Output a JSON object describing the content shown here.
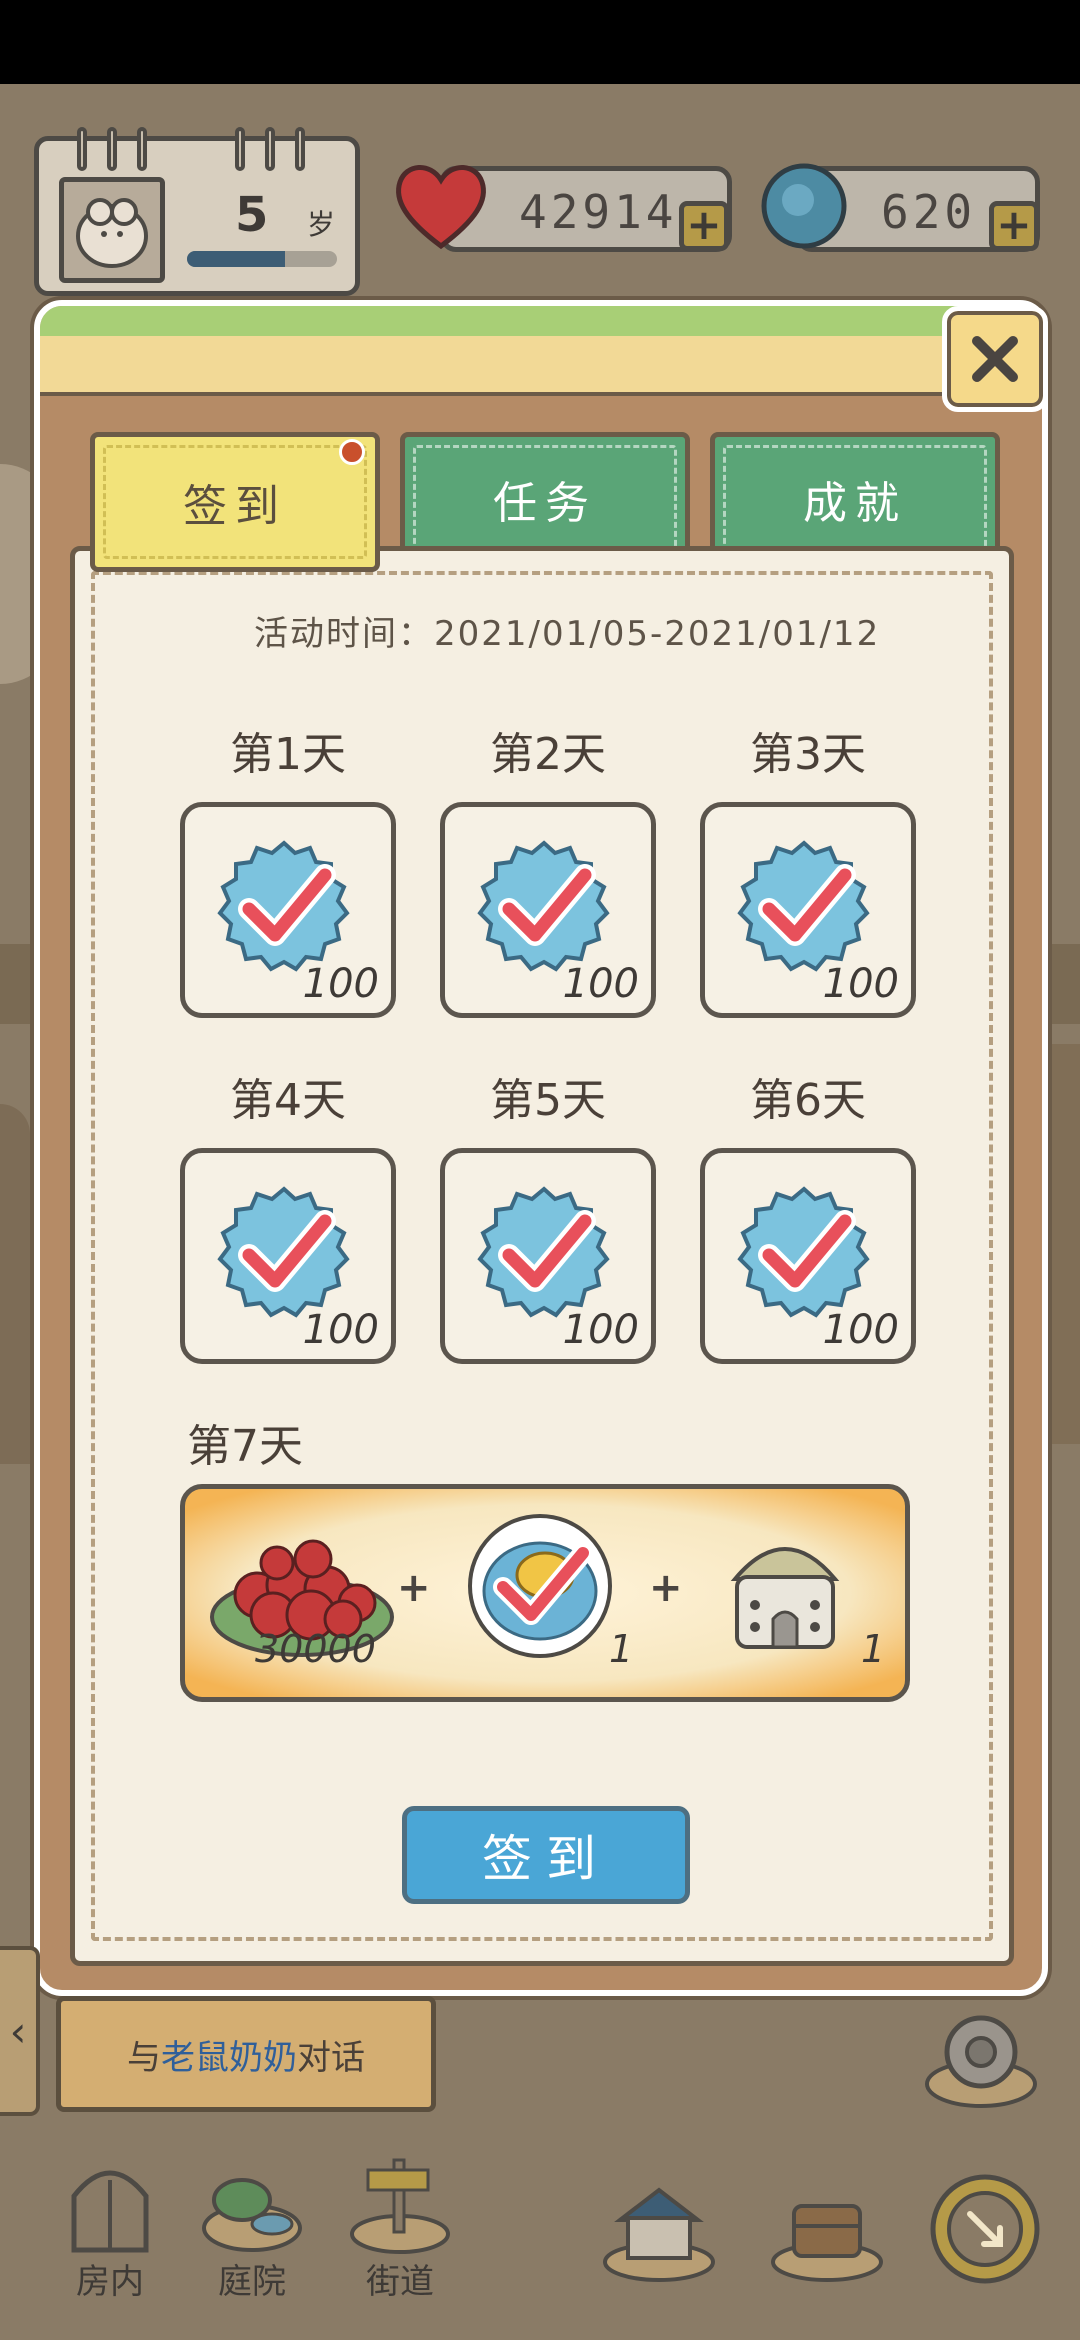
{
  "hud": {
    "age_value": "5",
    "age_unit": "岁",
    "age_progress": 0.65,
    "hearts": "42914",
    "caps": "620",
    "plus": "+"
  },
  "popup": {
    "close_icon": "close-icon",
    "tabs": [
      {
        "label": "签到",
        "active": true,
        "has_badge": true
      },
      {
        "label": "任务",
        "active": false
      },
      {
        "label": "成就",
        "active": false
      }
    ],
    "event_time": "活动时间：2021/01/05-2021/01/12",
    "days": [
      {
        "label": "第1天",
        "amount": "100",
        "claimed": true
      },
      {
        "label": "第2天",
        "amount": "100",
        "claimed": true
      },
      {
        "label": "第3天",
        "amount": "100",
        "claimed": true
      },
      {
        "label": "第4天",
        "amount": "100",
        "claimed": true
      },
      {
        "label": "第5天",
        "amount": "100",
        "claimed": true
      },
      {
        "label": "第6天",
        "amount": "100",
        "claimed": true
      }
    ],
    "day7": {
      "label": "第7天",
      "rewards": [
        {
          "icon": "hearts-plate-icon",
          "qty": "30000"
        },
        {
          "icon": "egg-plate-icon",
          "qty": "1",
          "claimed": true
        },
        {
          "icon": "house-icon",
          "qty": "1"
        }
      ],
      "plus": "+"
    },
    "signin_button": "签到"
  },
  "bottom": {
    "quest_prefix": "与",
    "quest_name": "老鼠奶奶",
    "quest_suffix": "对话",
    "back_arrow": "‹",
    "nav": [
      {
        "label": "房内",
        "icon": "door-icon"
      },
      {
        "label": "庭院",
        "icon": "garden-icon"
      },
      {
        "label": "街道",
        "icon": "signpost-icon"
      }
    ]
  },
  "colors": {
    "accent_blue": "#4aa6d6",
    "tab_green": "#5aa577",
    "tab_yellow": "#f2e37a",
    "check_red": "#e8505b",
    "cap_blue": "#7cc3de"
  }
}
